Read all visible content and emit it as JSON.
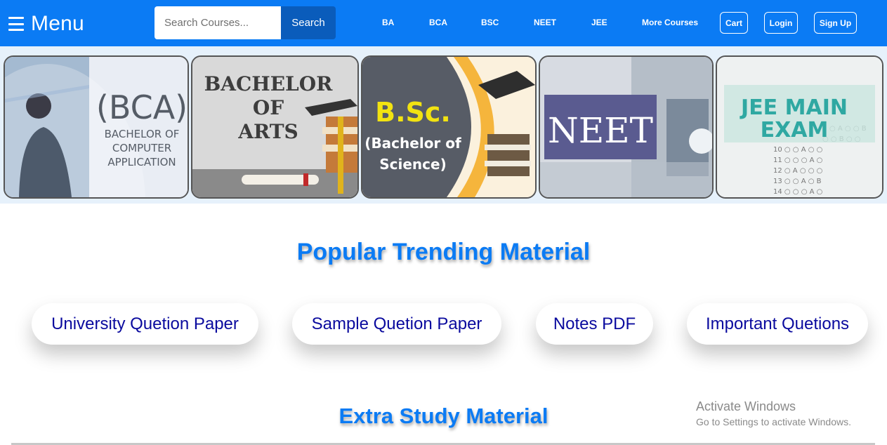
{
  "header": {
    "menu_label": "Menu",
    "search_placeholder": "Search Courses...",
    "search_button": "Search",
    "nav_links": [
      "BA",
      "BCA",
      "BSC",
      "NEET",
      "JEE",
      "More Courses"
    ],
    "buttons": [
      "Cart",
      "Login",
      "Sign Up"
    ]
  },
  "banner": {
    "cards": [
      {
        "line1": "(BCA)",
        "line2": "BACHELOR OF",
        "line3": "COMPUTER",
        "line4": "APPLICATION"
      },
      {
        "line1": "BACHELOR",
        "line2": "OF",
        "line3": "ARTS"
      },
      {
        "line1": "B.Sc.",
        "line2": "(Bachelor of",
        "line3": "Science)"
      },
      {
        "line1": "NEET"
      },
      {
        "line1": "JEE MAIN",
        "line2": "EXAM"
      }
    ]
  },
  "popular": {
    "title": "Popular Trending Material",
    "items": [
      "University Quetion Paper",
      "Sample Quetion Paper",
      "Notes PDF",
      "Important Quetions"
    ]
  },
  "extra": {
    "title": "Extra Study Material"
  },
  "watermark": {
    "title": "Activate Windows",
    "subtitle": "Go to Settings to activate Windows."
  },
  "colors": {
    "header_bg": "#0b7bf4",
    "search_button_bg": "#0a5cbb",
    "title_color": "#0b7bf4",
    "pill_text": "#0a0a9e"
  }
}
